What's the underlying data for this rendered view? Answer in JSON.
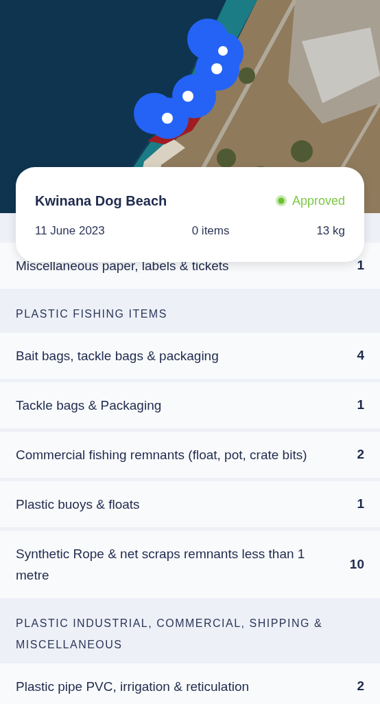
{
  "site": {
    "name": "Kwinana Dog Beach",
    "status": "Approved",
    "date": "11 June 2023",
    "items": "0 items",
    "weight": "13 kg"
  },
  "rows": [
    {
      "kind": "item",
      "label": "Miscellaneous paper, labels & tickets",
      "count": "1"
    },
    {
      "kind": "header",
      "label": "PLASTIC FISHING ITEMS"
    },
    {
      "kind": "item",
      "label": "Bait bags, tackle bags & packaging",
      "count": "4"
    },
    {
      "kind": "item",
      "label": "Tackle bags & Packaging",
      "count": "1"
    },
    {
      "kind": "item",
      "label": "Commercial fishing remnants (float, pot, crate bits)",
      "count": "2"
    },
    {
      "kind": "item",
      "label": "Plastic buoys & floats",
      "count": "1"
    },
    {
      "kind": "item",
      "label": "Synthetic Rope & net scraps remnants less than 1 metre",
      "count": "10"
    },
    {
      "kind": "header",
      "label": "PLASTIC INDUSTRIAL, COMMERCIAL, SHIPPING & MISCELLANEOUS"
    },
    {
      "kind": "item",
      "label": "Plastic pipe PVC, irrigation & reticulation",
      "count": "2"
    }
  ]
}
